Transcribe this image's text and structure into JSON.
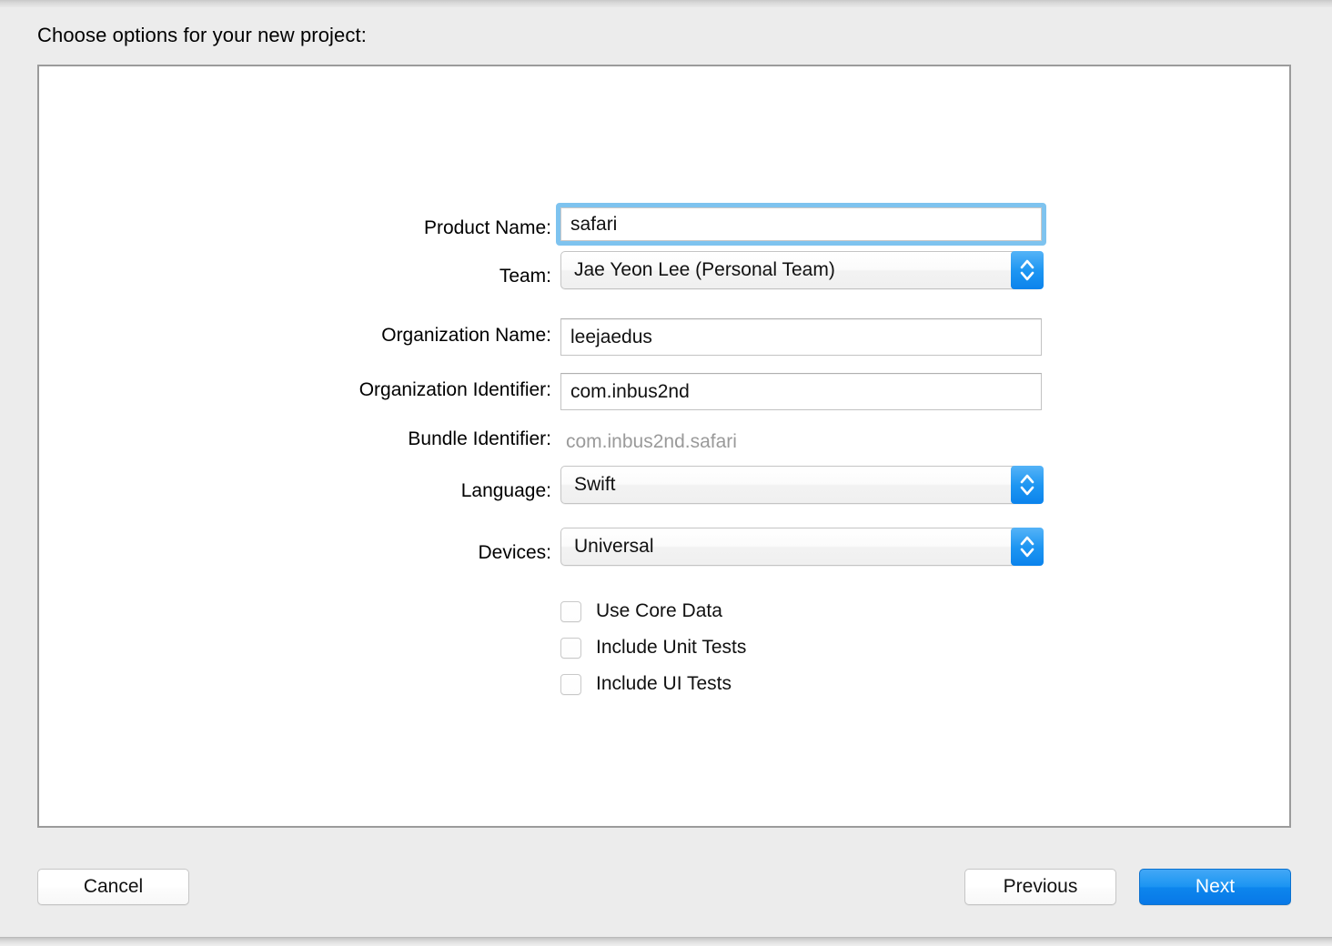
{
  "window": {
    "title_prompt": "Choose options for your new project:"
  },
  "form": {
    "fields": [
      {
        "label": "Product Name:",
        "value": "safari",
        "type": "text",
        "focused": true
      },
      {
        "label": "Team:",
        "value": "Jae Yeon Lee (Personal Team)",
        "type": "popup"
      },
      {
        "label": "Organization Name:",
        "value": "leejaedus",
        "type": "text"
      },
      {
        "label": "Organization Identifier:",
        "value": "com.inbus2nd",
        "type": "text"
      },
      {
        "label": "Bundle Identifier:",
        "value": "com.inbus2nd.safari",
        "type": "static"
      },
      {
        "label": "Language:",
        "value": "Swift",
        "type": "popup"
      },
      {
        "label": "Devices:",
        "value": "Universal",
        "type": "popup"
      }
    ],
    "checkboxes": [
      {
        "label": "Use Core Data",
        "checked": false
      },
      {
        "label": "Include Unit Tests",
        "checked": false
      },
      {
        "label": "Include UI Tests",
        "checked": false
      }
    ]
  },
  "footer": {
    "cancel_label": "Cancel",
    "previous_label": "Previous",
    "next_label": "Next"
  },
  "colors": {
    "accent_blue": "#1b94f2",
    "focus_ring": "#7ec3ef",
    "background": "#ececec",
    "content_background": "#ffffff",
    "muted_text": "#9a9a9a"
  }
}
